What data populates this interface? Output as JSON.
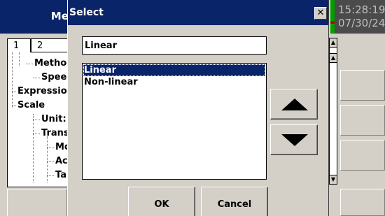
{
  "app": {
    "title": "Mea",
    "time": "15:28:19",
    "date": "07/30/24",
    "tabs": [
      {
        "label": "1"
      },
      {
        "label": "2"
      }
    ],
    "tree_items": [
      {
        "label": "Method"
      },
      {
        "label": "Speed"
      },
      {
        "label": "Expression"
      },
      {
        "label": "Scale"
      },
      {
        "label": "Unit:"
      },
      {
        "label": "Transform"
      },
      {
        "label": "Mo"
      },
      {
        "label": "Ac"
      },
      {
        "label": "Ta"
      }
    ]
  },
  "dialog": {
    "title": "Select",
    "close_label": "✕",
    "value": "Linear",
    "options": [
      {
        "label": "Linear",
        "selected": true
      },
      {
        "label": "Non-linear",
        "selected": false
      }
    ],
    "ok_label": "OK",
    "cancel_label": "Cancel",
    "icons": {
      "move_up": "arrow-up-icon",
      "move_down": "arrow-down-icon"
    }
  },
  "colors": {
    "titlebar": "#0a246a",
    "selection": "#0a246a",
    "status_green": "#00a000",
    "clock_bg": "#4b4b4b"
  }
}
